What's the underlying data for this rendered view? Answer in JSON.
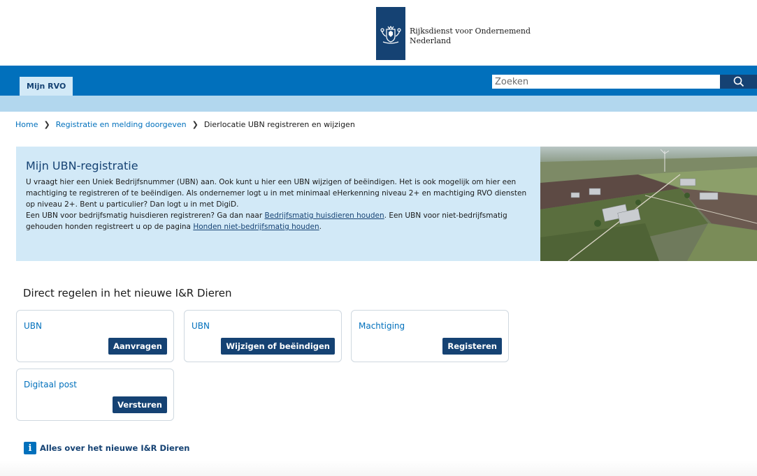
{
  "logo": {
    "line1": "Rijksdienst voor Ondernemend",
    "line2": "Nederland",
    "emblem_icon": "rijkswapen-icon"
  },
  "nav": {
    "tab_label": "Mijn RVO",
    "search_placeholder": "Zoeken",
    "search_icon": "search-icon"
  },
  "breadcrumb": {
    "items": [
      {
        "label": "Home",
        "link": true
      },
      {
        "label": "Registratie en melding doorgeven",
        "link": true
      },
      {
        "label": "Dierlocatie UBN registreren en wijzigen",
        "link": false
      }
    ]
  },
  "intro": {
    "title": "Mijn UBN-registratie",
    "p1": "U vraagt hier een Uniek Bedrijfsnummer (UBN) aan. Ook kunt u hier een UBN wijzigen of beëindigen. Het is ook mogelijk om hier een machtiging te registreren of te beëindigen. Als ondernemer logt u in met minimaal eHerkenning niveau 2+ en machtiging RVO diensten op niveau 2+. Bent u particulier? Dan logt u in met DigiD.",
    "p2_before": "Een UBN voor bedrijfsmatig huisdieren registreren? Ga dan naar ",
    "p2_link1": "Bedrijfsmatig huisdieren houden",
    "p2_middle": ". Een UBN voor niet-bedrijfsmatig gehouden honden registreert u op de pagina ",
    "p2_link2": "Honden niet-bedrijfsmatig houden",
    "p2_after": "."
  },
  "section": {
    "title": "Direct regelen in het nieuwe I&R Dieren"
  },
  "cards": [
    {
      "label": "UBN",
      "button": "Aanvragen"
    },
    {
      "label": "UBN",
      "button": "Wijzigen of beëindigen"
    },
    {
      "label": "Machtiging",
      "button": "Registeren"
    },
    {
      "label": "Digitaal post",
      "button": "Versturen"
    }
  ],
  "info": {
    "icon": "info-icon",
    "icon_glyph": "i",
    "link": "Alles over het nieuwe I&R Dieren"
  },
  "colors": {
    "primary_blue": "#0170bc",
    "dark_blue": "#154273",
    "light_blue": "#d2e9f7",
    "mid_blue": "#b2d7ee"
  }
}
